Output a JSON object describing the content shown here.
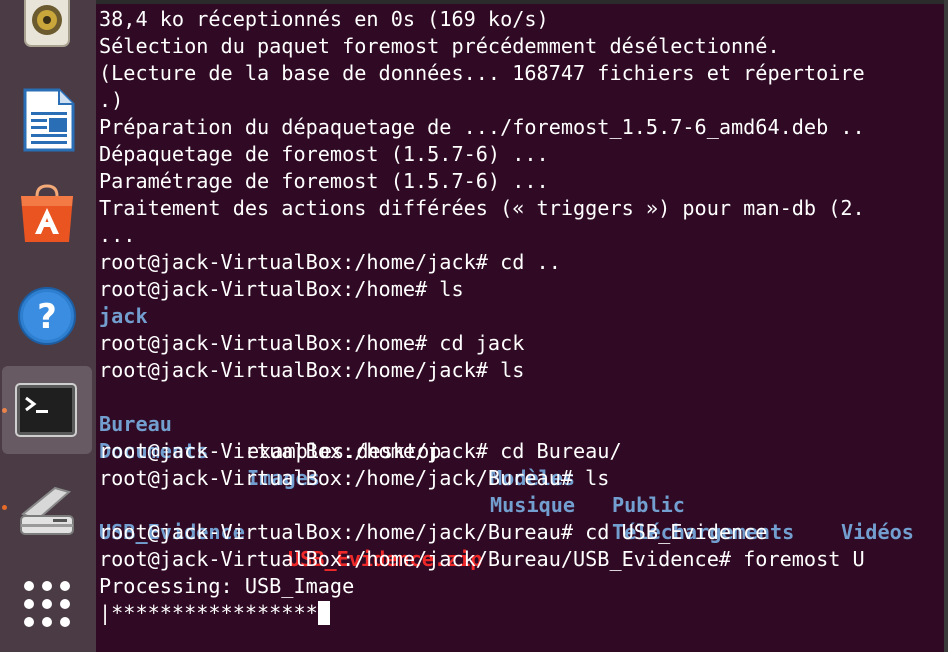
{
  "launcher": {
    "items": [
      {
        "name": "rhythmbox-icon"
      },
      {
        "name": "libreoffice-writer-icon"
      },
      {
        "name": "ubuntu-software-icon"
      },
      {
        "name": "help-icon"
      },
      {
        "name": "terminal-icon"
      },
      {
        "name": "scanner-icon"
      },
      {
        "name": "show-applications-icon"
      }
    ]
  },
  "terminal": {
    "lines": [
      "38,4 ko réceptionnés en 0s (169 ko/s)",
      "Sélection du paquet foremost précédemment désélectionné.",
      "(Lecture de la base de données... 168747 fichiers et répertoire",
      ".)",
      "Préparation du dépaquetage de .../foremost_1.5.7-6_amd64.deb ..",
      "Dépaquetage de foremost (1.5.7-6) ...",
      "Paramétrage de foremost (1.5.7-6) ...",
      "Traitement des actions différées (« triggers ») pour man-db (2.",
      "...",
      "root@jack-VirtualBox:/home/jack# cd ..",
      "root@jack-VirtualBox:/home# ls"
    ],
    "ls_home": "jack",
    "cmd_cd_jack": "root@jack-VirtualBox:/home# cd jack",
    "cmd_ls_jack": "root@jack-VirtualBox:/home/jack# ls",
    "ls_jack": {
      "row1": [
        "Bureau",
        "examples.desktop",
        "Modèles",
        "Public",
        "Vidéos"
      ],
      "row2": [
        "Documents",
        "Images",
        "Musique",
        "Téléchargements"
      ]
    },
    "cmd_cd_bureau": "root@jack-VirtualBox:/home/jack# cd Bureau/",
    "cmd_ls_bureau": "root@jack-VirtualBox:/home/jack/Bureau# ls",
    "ls_bureau": {
      "dir": "USB_Evidence",
      "zip": "USB_Evidence.zip"
    },
    "cmd_cd_evidence": "root@jack-VirtualBox:/home/jack/Bureau# cd USB_Evidence",
    "cmd_foremost": "root@jack-VirtualBox:/home/jack/Bureau/USB_Evidence# foremost U",
    "processing": "Processing: USB_Image",
    "progress": "|*****************"
  }
}
